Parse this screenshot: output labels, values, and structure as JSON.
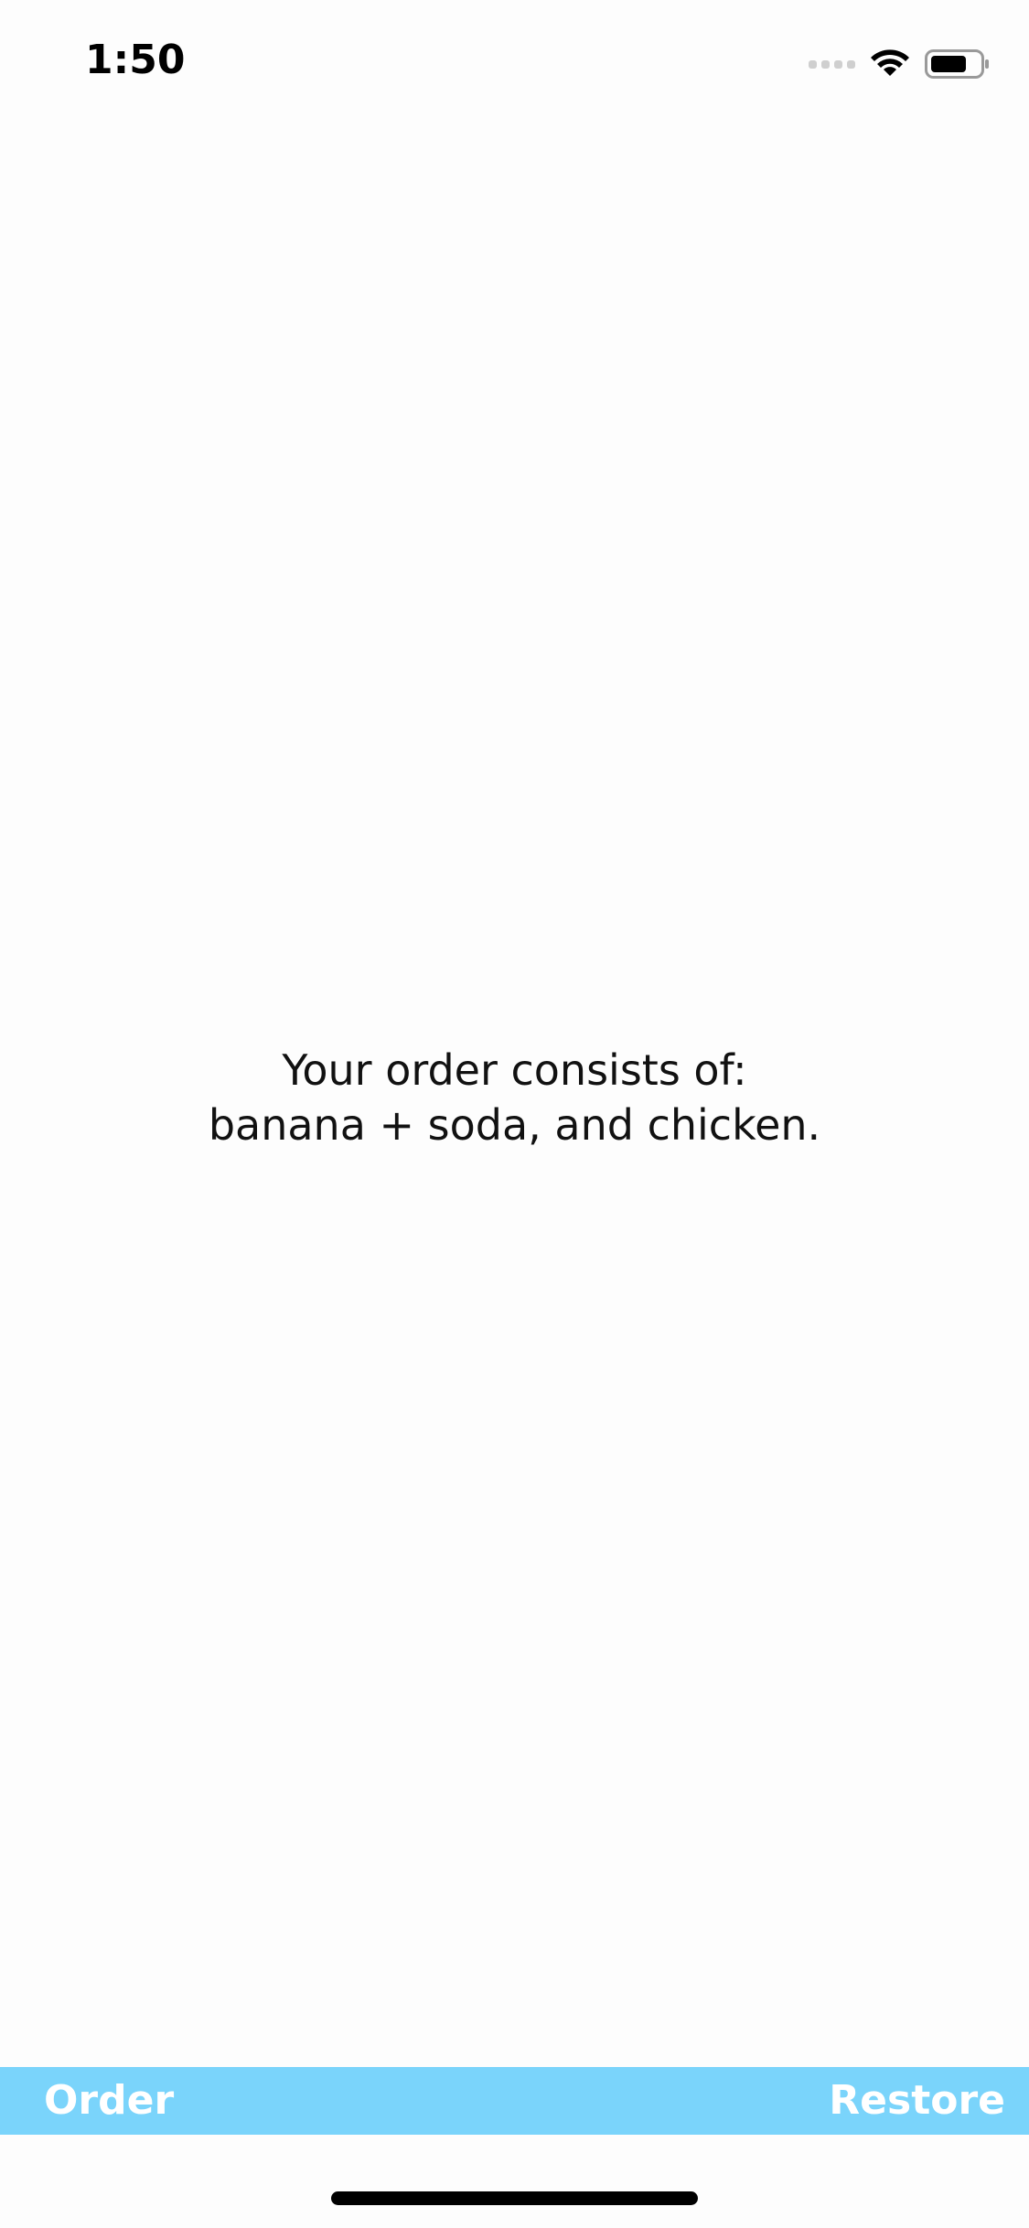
{
  "status_bar": {
    "time": "1:50",
    "icons": [
      "cellular-signal-icon",
      "wifi-icon",
      "battery-icon"
    ]
  },
  "main": {
    "order_line1": "Your order consists of:",
    "order_line2": "banana + soda, and chicken."
  },
  "toolbar": {
    "background_color": "#7ad4fb",
    "left_button_label": "Order",
    "right_button_label": "Restore"
  }
}
